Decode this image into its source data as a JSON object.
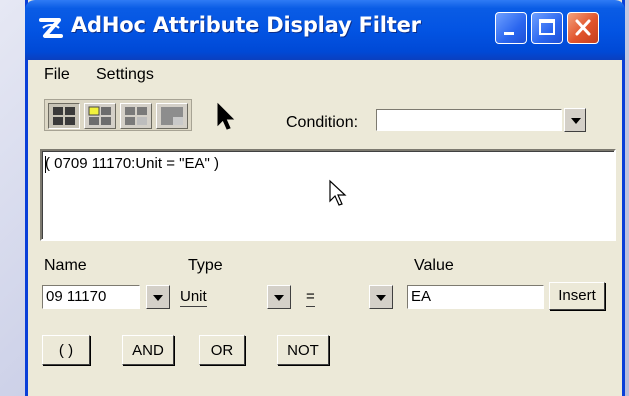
{
  "window": {
    "title": "AdHoc Attribute Display Filter",
    "accent": "#0a3fd8",
    "face": "#ece9d8"
  },
  "titlebar_buttons": {
    "minimize_icon": "minimize-icon",
    "maximize_icon": "maximize-icon",
    "close_icon": "close-icon"
  },
  "menu": {
    "items": [
      {
        "label": "File"
      },
      {
        "label": "Settings"
      }
    ]
  },
  "toolbar": {
    "layout_buttons": [
      "layout-1-icon",
      "layout-2-icon",
      "layout-3-icon",
      "layout-4-icon"
    ],
    "pointer_icon": "arrow-pointer-icon",
    "condition_label": "Condition:",
    "condition_value": ""
  },
  "expression": {
    "text": "( 0709 11170:Unit  = \"EA\" )"
  },
  "criteria": {
    "name_label": "Name",
    "type_label": "Type",
    "value_label": "Value",
    "name_value": "09 11170",
    "type_value": "Unit",
    "operator_value": "=",
    "value_value": "EA",
    "insert_label": "Insert"
  },
  "operators": {
    "paren_label": "( )",
    "and_label": "AND",
    "or_label": "OR",
    "not_label": "NOT"
  }
}
